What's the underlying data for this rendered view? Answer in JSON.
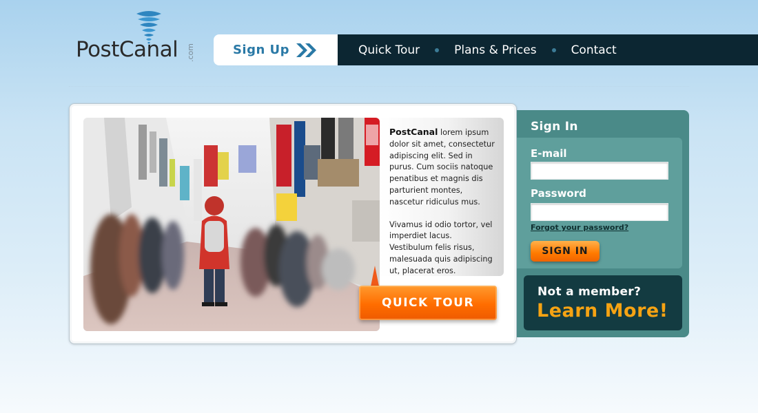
{
  "logo": {
    "name": "PostCanal",
    "suffix": ".com"
  },
  "nav": {
    "signup_label": "Sign Up",
    "items": [
      "Quick Tour",
      "Plans & Prices",
      "Contact"
    ]
  },
  "intro": {
    "brand": "PostCanal",
    "paragraph1": " lorem ipsum dolor sit amet, consectetur adipiscing elit. Sed in purus. Cum sociis natoque penatibus et magnis dis parturient montes, nascetur ridiculus mus.",
    "paragraph2": "Vivamus id odio tortor, vel imperdiet lacus. Vestibulum felis risus, malesuada quis adipiscing ut, placerat eros.",
    "cta": "QUICK TOUR"
  },
  "signin": {
    "title": "Sign In",
    "email_label": "E-mail",
    "email_value": "",
    "password_label": "Password",
    "password_value": "",
    "forgot": "Forgot your password?",
    "button": "SIGN IN"
  },
  "member": {
    "question": "Not a member?",
    "cta": "Learn More!"
  },
  "colors": {
    "nav_dark": "#0c2632",
    "signin_panel": "#4a8a88",
    "member_box": "#133b41",
    "accent_orange": "#ff7a00",
    "learn_more": "#f6a313",
    "signup_blue": "#2a79a6"
  },
  "icons": [
    "tornado-logo-icon",
    "double-chevron-right-icon"
  ],
  "image": {
    "description_icon": "city-street-photo"
  }
}
